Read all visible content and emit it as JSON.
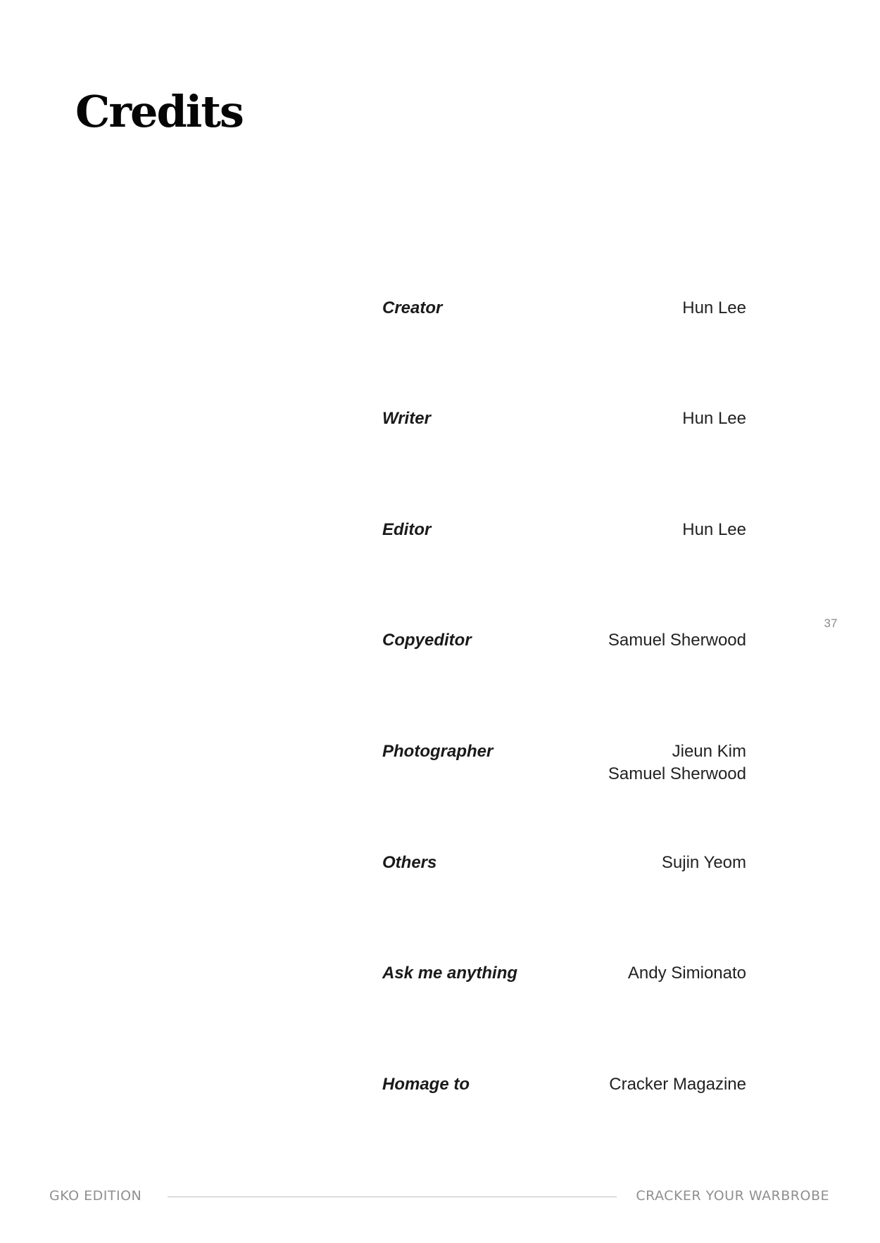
{
  "page": {
    "title": "Credits",
    "page_number": "37"
  },
  "credits": [
    {
      "role": "Creator",
      "names": [
        "Hun Lee"
      ]
    },
    {
      "role": "Writer",
      "names": [
        "Hun Lee"
      ]
    },
    {
      "role": "Editor",
      "names": [
        "Hun Lee"
      ]
    },
    {
      "role": "Copyeditor",
      "names": [
        "Samuel Sherwood"
      ]
    },
    {
      "role": "Photographer",
      "names": [
        "Jieun Kim",
        "Samuel Sherwood"
      ]
    },
    {
      "role": "Others",
      "names": [
        "Sujin Yeom"
      ]
    },
    {
      "role": "Ask me anything",
      "names": [
        "Andy Simionato"
      ]
    },
    {
      "role": "Homage to",
      "names": [
        "Cracker Magazine"
      ]
    }
  ],
  "footer": {
    "left": "GKO EDITION",
    "right": "CRACKER YOUR WARBROBE"
  }
}
